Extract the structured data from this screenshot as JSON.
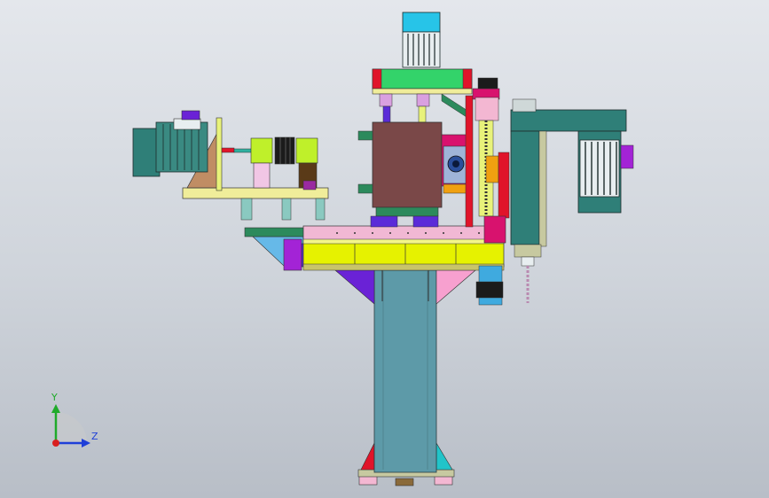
{
  "viewport": {
    "background_top": "#e4e7ec",
    "background_bottom": "#b8bec7"
  },
  "triad": {
    "y_label": "Y",
    "z_label": "Z",
    "y_color": "#1faa2a",
    "z_color": "#1f3fd8",
    "x_color": "#d81f1f"
  },
  "colors": {
    "motor_teal": "#2f7f78",
    "motor_dark": "#1d2b2b",
    "frame_yellow": "#e8f27a",
    "frame_lime": "#e6f200",
    "column_steel": "#5d9aa8",
    "block_brown": "#7a4848",
    "accent_magenta": "#d8126e",
    "accent_purple": "#7a2acf",
    "accent_pink": "#f3b7d2",
    "accent_green": "#33d36a",
    "accent_cyan": "#27c4e8"
  }
}
